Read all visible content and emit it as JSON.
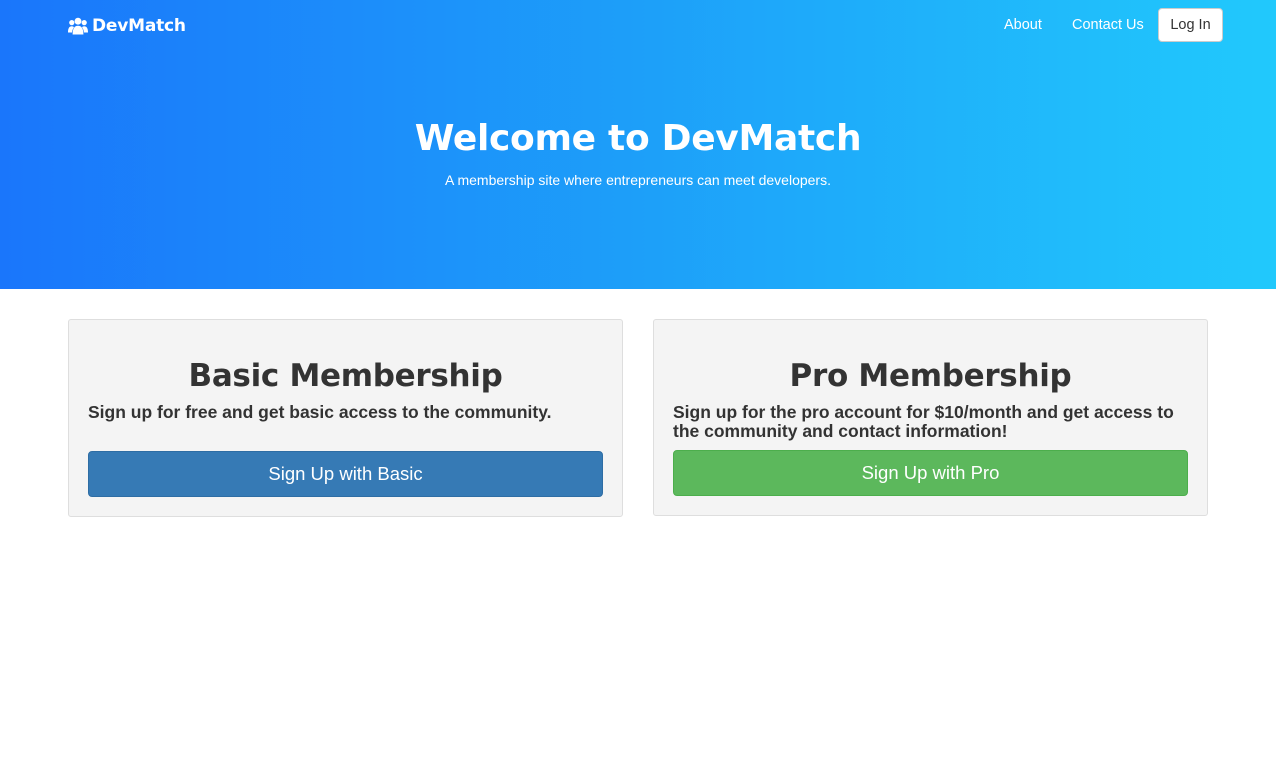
{
  "brand": {
    "name": "DevMatch",
    "icon": "users-icon"
  },
  "nav": {
    "about": "About",
    "contact": "Contact Us",
    "login": "Log In"
  },
  "hero": {
    "title": "Welcome to DevMatch",
    "subtitle": "A membership site where entrepreneurs can meet developers."
  },
  "plans": {
    "basic": {
      "title": "Basic Membership",
      "description": "Sign up for free and get basic access to the community.",
      "button": "Sign Up with Basic"
    },
    "pro": {
      "title": "Pro Membership",
      "description": "Sign up for the pro account for $10/month and get access to the community and contact information!",
      "button": "Sign Up with Pro"
    }
  },
  "colors": {
    "hero_gradient_start": "#1a76fb",
    "hero_gradient_end": "#21c9fc",
    "basic_button": "#367ab5",
    "pro_button": "#5cb85c",
    "card_background": "#f4f4f4"
  }
}
